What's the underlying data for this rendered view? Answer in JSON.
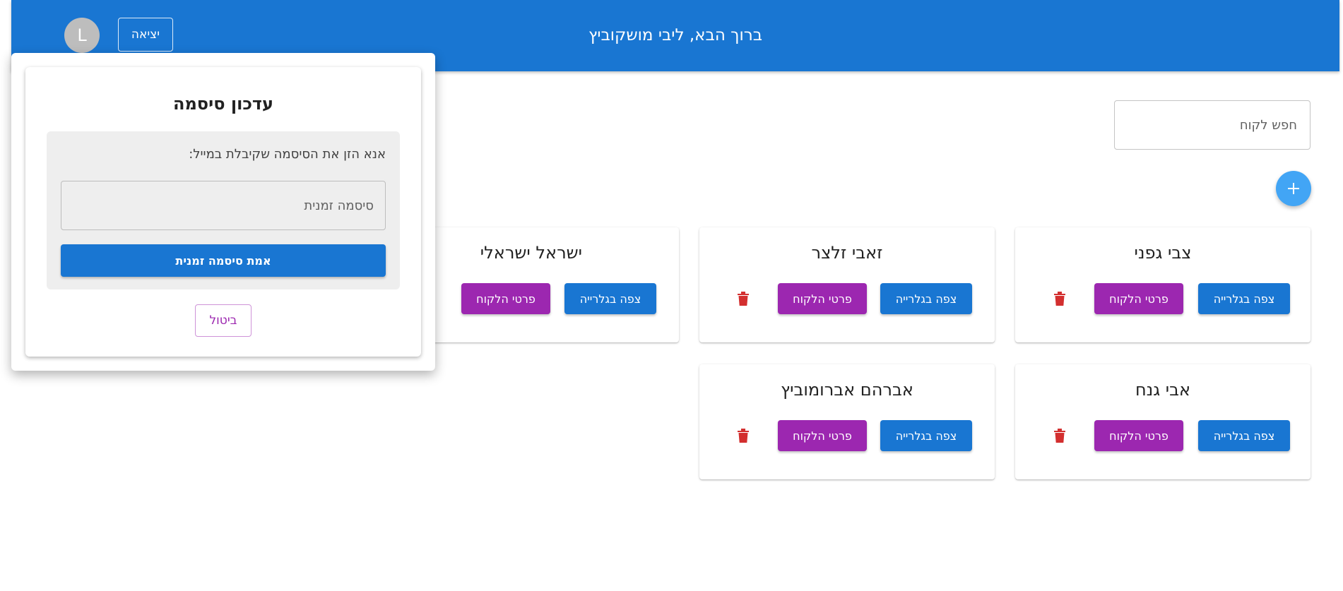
{
  "header": {
    "title": "ברוך הבא, ליבי מושקוביץ",
    "logout_label": "יציאה",
    "avatar_letter": "L"
  },
  "search": {
    "placeholder": "חפש לקוח"
  },
  "buttons": {
    "add_icon": "plus-icon",
    "gallery_label": "צפה בגלרייה",
    "details_label": "פרטי הלקוח",
    "delete_icon": "trash-icon"
  },
  "customers": [
    {
      "name": "צבי גפני"
    },
    {
      "name": "זאבי זלצר"
    },
    {
      "name": "ישראל ישראלי"
    },
    {
      "name": "אבי גנח"
    },
    {
      "name": "אברהם אברומוביץ"
    }
  ],
  "dialog": {
    "title": "עדכון סיסמה",
    "instruction": "אנא הזן את הסיסמה שקיבלת במייל:",
    "temp_password_placeholder": "סיסמה זמנית",
    "verify_label": "אמת סיסמה זמנית",
    "cancel_label": "ביטול"
  },
  "colors": {
    "primary": "#1976d2",
    "secondary": "#9c27b0",
    "fab": "#42a5f5",
    "danger": "#d32f2f"
  }
}
